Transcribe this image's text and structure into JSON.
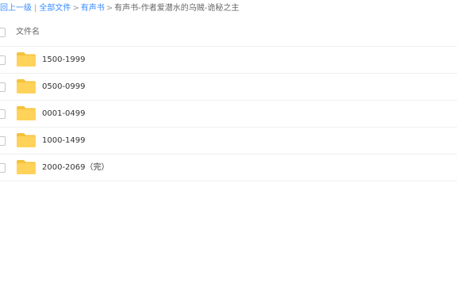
{
  "breadcrumb": {
    "back": "返回上一级",
    "separator_bar": "|",
    "all_files": "全部文件",
    "arrow_1": ">",
    "parent": "有声书",
    "arrow_2": ">",
    "current": "有声书-作者爱潜水的乌贼-诡秘之主"
  },
  "list": {
    "header_label": "文件名",
    "rows": [
      {
        "name": "1500-1999",
        "icon": "folder-icon"
      },
      {
        "name": "0500-0999",
        "icon": "folder-icon"
      },
      {
        "name": "0001-0499",
        "icon": "folder-icon"
      },
      {
        "name": "1000-1499",
        "icon": "folder-icon"
      },
      {
        "name": "2000-2069（完）",
        "icon": "folder-icon"
      }
    ]
  },
  "colors": {
    "link": "#3b8cff",
    "folder": "#ffd25a",
    "folder_tab": "#f5c23b"
  }
}
